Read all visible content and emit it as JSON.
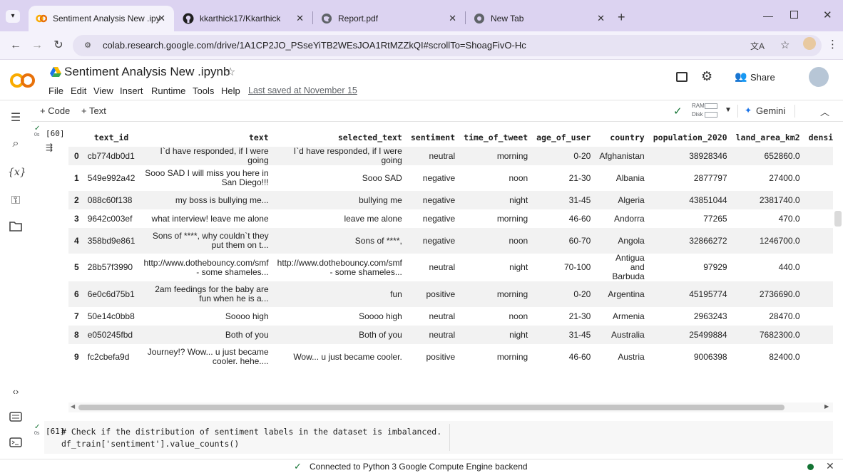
{
  "browser": {
    "tabs": [
      {
        "title": "Sentiment Analysis New .ipynb",
        "favicon": "colab-icon"
      },
      {
        "title": "kkarthick17/Kkarthick",
        "favicon": "github-icon"
      },
      {
        "title": "Report.pdf",
        "favicon": "globe-icon"
      },
      {
        "title": "New Tab",
        "favicon": "chrome-icon"
      }
    ],
    "new_tab": "+",
    "url": "colab.research.google.com/drive/1A1CP2JO_PSseYiTB2WEsJOA1RtMZZkQI#scrollTo=ShoagFivO-Hc"
  },
  "colab": {
    "logo": "CO",
    "notebook_title": "Sentiment Analysis New .ipynb",
    "menu": [
      "File",
      "Edit",
      "View",
      "Insert",
      "Runtime",
      "Tools",
      "Help"
    ],
    "last_saved": "Last saved at November 15",
    "share": "Share",
    "toolbar": {
      "add_code": "+ Code",
      "add_text": "+ Text",
      "ram": "RAM",
      "disk": "Disk",
      "gemini": "Gemini"
    }
  },
  "cell60": {
    "exec_count": "[60]",
    "run_time": "0s",
    "columns": [
      "",
      "text_id",
      "text",
      "selected_text",
      "sentiment",
      "time_of_tweet",
      "age_of_user",
      "country",
      "population_2020",
      "land_area_km2",
      "densi"
    ],
    "rows": [
      {
        "idx": "0",
        "text_id": "cb774db0d1",
        "text": "I`d have responded, if I were going",
        "selected_text": "I`d have responded, if I were going",
        "sentiment": "neutral",
        "time": "morning",
        "age": "0-20",
        "country": "Afghanistan",
        "pop": "38928346",
        "land": "652860.0"
      },
      {
        "idx": "1",
        "text_id": "549e992a42",
        "text": "Sooo SAD I will miss you here in San Diego!!!",
        "selected_text": "Sooo SAD",
        "sentiment": "negative",
        "time": "noon",
        "age": "21-30",
        "country": "Albania",
        "pop": "2877797",
        "land": "27400.0"
      },
      {
        "idx": "2",
        "text_id": "088c60f138",
        "text": "my boss is bullying me...",
        "selected_text": "bullying me",
        "sentiment": "negative",
        "time": "night",
        "age": "31-45",
        "country": "Algeria",
        "pop": "43851044",
        "land": "2381740.0"
      },
      {
        "idx": "3",
        "text_id": "9642c003ef",
        "text": "what interview! leave me alone",
        "selected_text": "leave me alone",
        "sentiment": "negative",
        "time": "morning",
        "age": "46-60",
        "country": "Andorra",
        "pop": "77265",
        "land": "470.0"
      },
      {
        "idx": "4",
        "text_id": "358bd9e861",
        "text": "Sons of ****, why couldn`t they put them on t...",
        "selected_text": "Sons of ****,",
        "sentiment": "negative",
        "time": "noon",
        "age": "60-70",
        "country": "Angola",
        "pop": "32866272",
        "land": "1246700.0"
      },
      {
        "idx": "5",
        "text_id": "28b57f3990",
        "text": "http://www.dothebouncy.com/smf - some shameles...",
        "selected_text": "http://www.dothebouncy.com/smf - some shameles...",
        "sentiment": "neutral",
        "time": "night",
        "age": "70-100",
        "country": "Antigua and Barbuda",
        "pop": "97929",
        "land": "440.0"
      },
      {
        "idx": "6",
        "text_id": "6e0c6d75b1",
        "text": "2am feedings for the baby are fun when he is a...",
        "selected_text": "fun",
        "sentiment": "positive",
        "time": "morning",
        "age": "0-20",
        "country": "Argentina",
        "pop": "45195774",
        "land": "2736690.0"
      },
      {
        "idx": "7",
        "text_id": "50e14c0bb8",
        "text": "Soooo high",
        "selected_text": "Soooo high",
        "sentiment": "neutral",
        "time": "noon",
        "age": "21-30",
        "country": "Armenia",
        "pop": "2963243",
        "land": "28470.0"
      },
      {
        "idx": "8",
        "text_id": "e050245fbd",
        "text": "Both of you",
        "selected_text": "Both of you",
        "sentiment": "neutral",
        "time": "night",
        "age": "31-45",
        "country": "Australia",
        "pop": "25499884",
        "land": "7682300.0"
      },
      {
        "idx": "9",
        "text_id": "fc2cbefa9d",
        "text": "Journey!? Wow... u just became cooler. hehe....",
        "selected_text": "Wow... u just became cooler.",
        "sentiment": "positive",
        "time": "morning",
        "age": "46-60",
        "country": "Austria",
        "pop": "9006398",
        "land": "82400.0"
      }
    ]
  },
  "cell61": {
    "exec_count": "[61]",
    "run_time": "0s",
    "line1": "# Check if the distribution of sentiment labels in the dataset is imbalanced.",
    "line2": "df_train['sentiment'].value_counts()"
  },
  "status": {
    "text": "Connected to Python 3 Google Compute Engine backend"
  },
  "colors": {
    "tab_strip": "#dcd3f1",
    "accent": "#1a73e8",
    "colab_orange": "#f9ab00",
    "ok_green": "#137333"
  }
}
